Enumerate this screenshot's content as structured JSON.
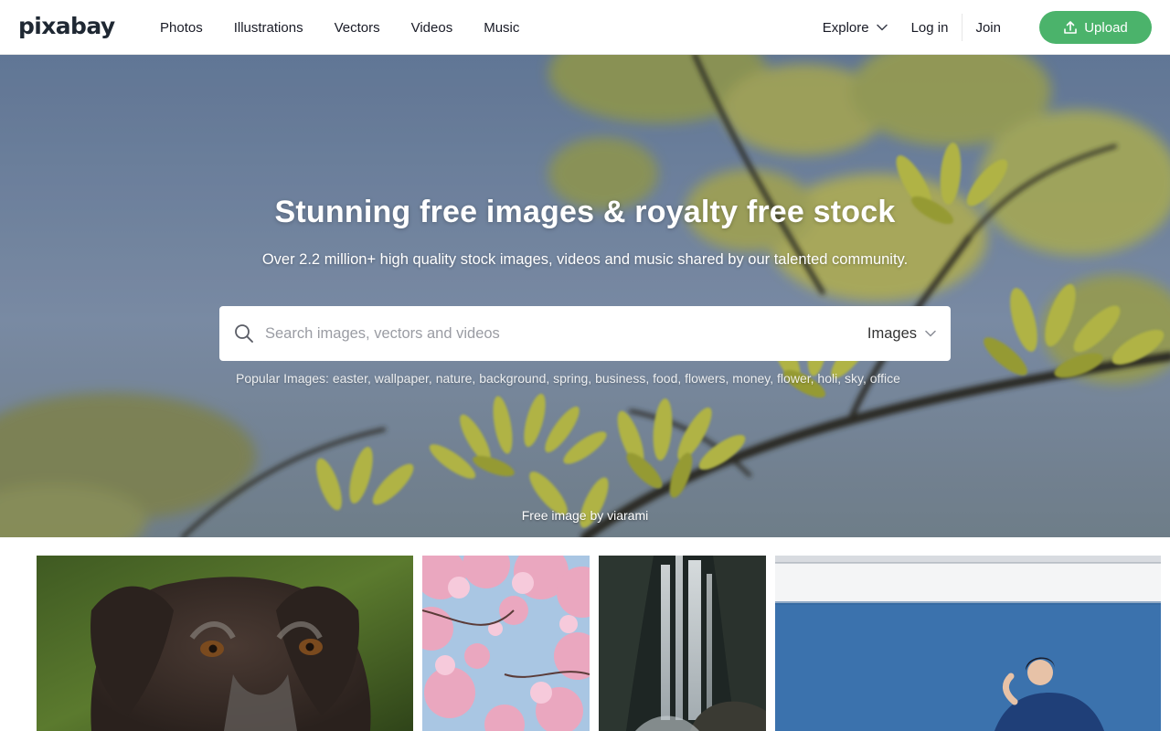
{
  "header": {
    "logo": "pixabay",
    "nav": [
      "Photos",
      "Illustrations",
      "Vectors",
      "Videos",
      "Music"
    ],
    "explore_label": "Explore",
    "login_label": "Log in",
    "join_label": "Join",
    "upload_label": "Upload",
    "accent_color": "#4bb36b"
  },
  "hero": {
    "title": "Stunning free images & royalty free stock",
    "subtitle": "Over 2.2 million+ high quality stock images, videos and music shared by our talented community.",
    "search": {
      "placeholder": "Search images, vectors and videos",
      "value": "",
      "filter_selected": "Images"
    },
    "popular_label": "Popular Images:",
    "popular_tags": [
      "easter",
      "wallpaper",
      "nature",
      "background",
      "spring",
      "business",
      "food",
      "flowers",
      "money",
      "flower",
      "holi",
      "sky",
      "office"
    ],
    "credit_prefix": "Free image by",
    "credit_author": "viarami"
  },
  "icons": {
    "search": "search-icon",
    "chevron": "chevron-down-icon",
    "upload": "upload-icon"
  }
}
